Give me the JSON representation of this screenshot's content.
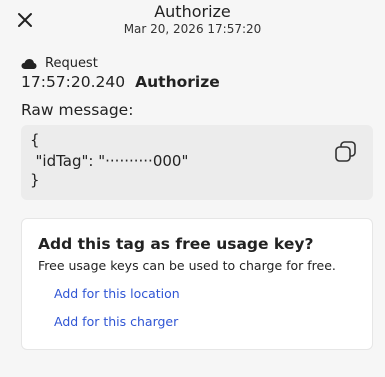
{
  "header": {
    "title": "Authorize",
    "timestamp": "Mar 20, 2026 17:57:20"
  },
  "icons": {
    "close": "close-icon",
    "direction": "cloud-icon",
    "copy": "copy-icon"
  },
  "message": {
    "direction_label": "Request",
    "time": "17:57:20.240",
    "action": "Authorize",
    "raw_label": "Raw message:",
    "raw_lines": [
      "{",
      "  \"idTag\": \"··········000\"",
      "}"
    ]
  },
  "free_usage_card": {
    "title": "Add this tag as free usage key?",
    "description": "Free usage keys can be used to charge for free.",
    "add_location_link": "Add for this location",
    "add_charger_link": "Add for this charger"
  },
  "colors": {
    "background": "#f6f6f6",
    "code_background": "#ececec",
    "link": "#2f55d4",
    "card_background": "#ffffff"
  }
}
